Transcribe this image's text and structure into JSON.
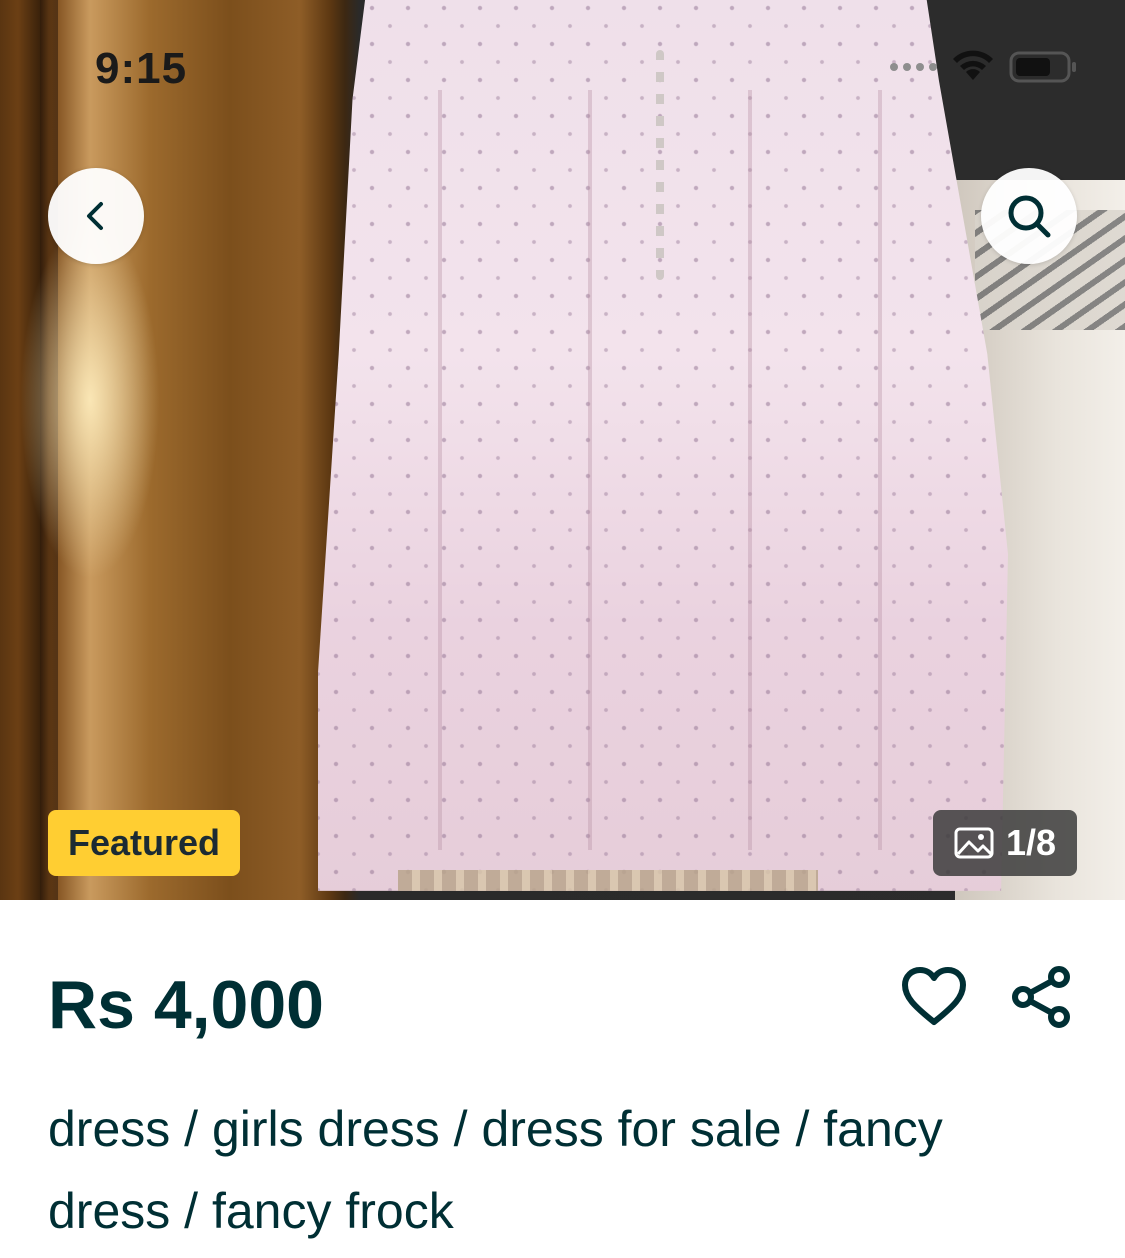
{
  "status_bar": {
    "time": "9:15"
  },
  "photo": {
    "alt": "listing photo",
    "badge": "Featured",
    "counter": "1/8"
  },
  "icons": {
    "back": "chevron-left-icon",
    "search": "search-icon",
    "gallery": "image-icon",
    "favorite": "heart-icon",
    "share": "share-icon",
    "wifi": "wifi-icon",
    "battery": "battery-icon"
  },
  "listing": {
    "price": "Rs 4,000",
    "title": "dress / girls dress / dress for sale / fancy dress / fancy frock"
  },
  "colors": {
    "badge_bg": "#ffce32",
    "text_primary": "#002f34"
  }
}
